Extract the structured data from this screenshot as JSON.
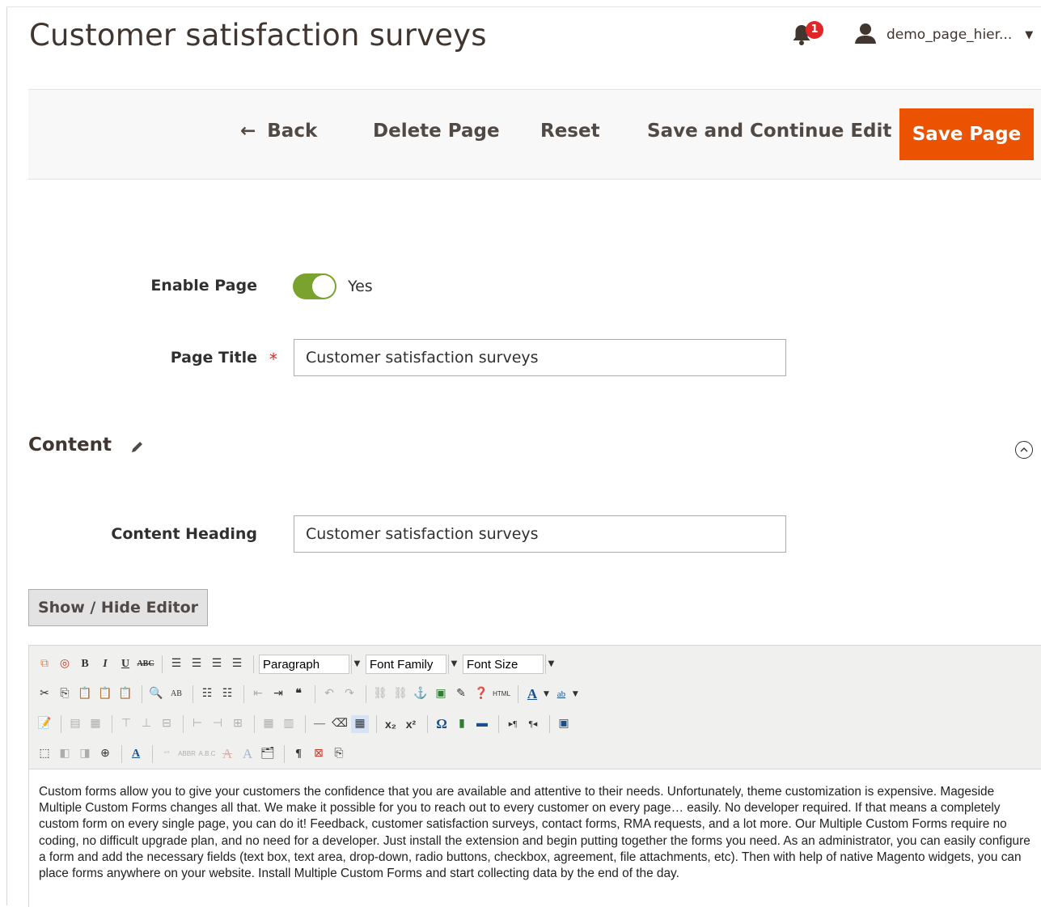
{
  "header": {
    "page_title": "Customer satisfaction surveys",
    "notification_count": "1",
    "user_name": "demo_page_hier..."
  },
  "actions": {
    "back": "Back",
    "delete": "Delete Page",
    "reset": "Reset",
    "save_continue": "Save and Continue Edit",
    "save": "Save Page"
  },
  "form": {
    "enable_label": "Enable Page",
    "enable_value": "Yes",
    "enabled": true,
    "title_label": "Page Title",
    "title_value": "Customer satisfaction surveys"
  },
  "content": {
    "section_title": "Content",
    "heading_label": "Content Heading",
    "heading_value": "Customer satisfaction surveys",
    "show_hide": "Show / Hide Editor"
  },
  "editor": {
    "format_select": "Paragraph",
    "font_family_select": "Font Family",
    "font_size_select": "Font Size",
    "body_text": "Custom forms allow you to give your customers the confidence that you are available and attentive to their needs. Unfortunately, theme customization is expensive. Mageside Multiple Custom Forms changes all that. We make it possible for you to reach out to every customer on every page… easily. No developer required. If that means a completely custom form on every single page, you can do it! Feedback, customer satisfaction surveys, contact forms, RMA requests, and a lot more. Our Multiple Custom Forms require no coding, no difficult upgrade plan, and no need for a developer. Just install the extension and begin putting together the forms you need. As an administrator, you can easily configure a form and add the necessary fields (text box, text area, drop-down, radio buttons, checkbox, agreement, file attachments, etc). Then with help of native Magento widgets, you can place forms anywhere on your website. Install Multiple Custom Forms and start collecting data by the end of the day."
  },
  "colors": {
    "accent": "#eb5202",
    "toggle_on": "#79a22e",
    "badge": "#e22626"
  }
}
